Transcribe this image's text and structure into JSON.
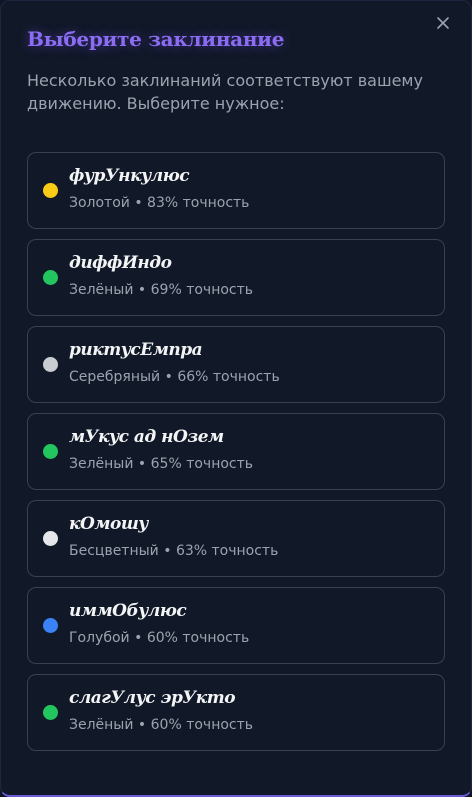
{
  "dialog": {
    "title": "Выберите заклинание",
    "subtitle": "Несколько заклинаний соответствуют вашему движению. Выберите нужное:",
    "close_icon": "close-icon"
  },
  "spells": [
    {
      "name": "фурУнкулюс",
      "color_name": "Золотой",
      "accuracy": "83% точность",
      "color": "#facc15"
    },
    {
      "name": "диффИндо",
      "color_name": "Зелёный",
      "accuracy": "69% точность",
      "color": "#22c55e"
    },
    {
      "name": "риктусЕмпра",
      "color_name": "Серебряный",
      "accuracy": "66% точность",
      "color": "#c9ccd1"
    },
    {
      "name": "мУкус ад нОзем",
      "color_name": "Зелёный",
      "accuracy": "65% точность",
      "color": "#22c55e"
    },
    {
      "name": "кОмошу",
      "color_name": "Бесцветный",
      "accuracy": "63% точность",
      "color": "#e5e7eb"
    },
    {
      "name": "иммОбулюс",
      "color_name": "Голубой",
      "accuracy": "60% точность",
      "color": "#3b82f6"
    },
    {
      "name": "слагУлус эрУкто",
      "color_name": "Зелёный",
      "accuracy": "60% точность",
      "color": "#22c55e"
    }
  ],
  "separator": " • "
}
